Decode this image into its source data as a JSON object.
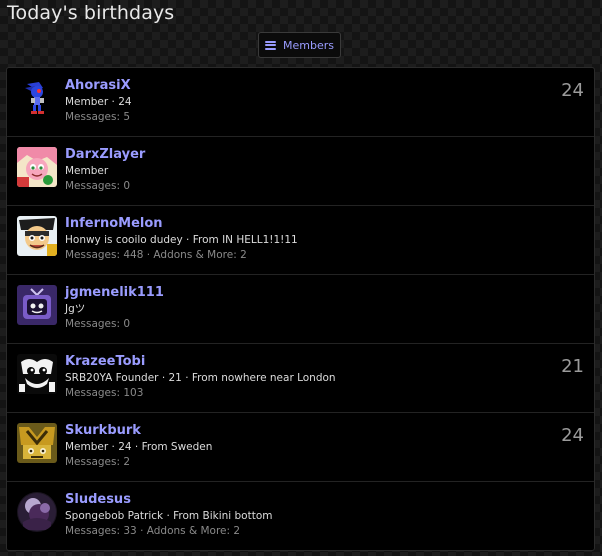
{
  "page": {
    "title": "Today's birthdays"
  },
  "toolbar": {
    "members_label": "Members"
  },
  "members": [
    {
      "username": "AhorasiX",
      "title_line": "Member · 24",
      "stats": "Messages: 5",
      "age": "24",
      "avatar_icon": "metal-sonic-avatar"
    },
    {
      "username": "DarxZlayer",
      "title_line": "Member",
      "stats": "Messages: 0",
      "age": "",
      "avatar_icon": "amy-rose-avatar"
    },
    {
      "username": "InfernoMelon",
      "title_line": "Honwy is cooilo dudey · From IN HELL1!1!11",
      "stats": "Messages: 448 · Addons & More: 2",
      "age": "",
      "avatar_icon": "cartoon-character-avatar"
    },
    {
      "username": "jgmenelik111",
      "title_line": "Jgツ",
      "stats": "Messages: 0",
      "age": "",
      "avatar_icon": "purple-tv-avatar"
    },
    {
      "username": "KrazeeTobi",
      "title_line": "SRB20YA Founder · 21 · From nowhere near London",
      "stats": "Messages: 103",
      "age": "21",
      "avatar_icon": "black-white-cartoon-avatar"
    },
    {
      "username": "Skurkburk",
      "title_line": "Member · 24 · From Sweden",
      "stats": "Messages: 2",
      "age": "24",
      "avatar_icon": "crash-bandicoot-avatar"
    },
    {
      "username": "Sludesus",
      "title_line": "Spongebob Patrick · From Bikini bottom",
      "stats": "Messages: 33 · Addons & More: 2",
      "age": "",
      "avatar_icon": "dark-purple-photo-avatar"
    }
  ],
  "colors": {
    "username": "#9a9cff",
    "background": "#000000",
    "age": "#9b9b9b"
  }
}
